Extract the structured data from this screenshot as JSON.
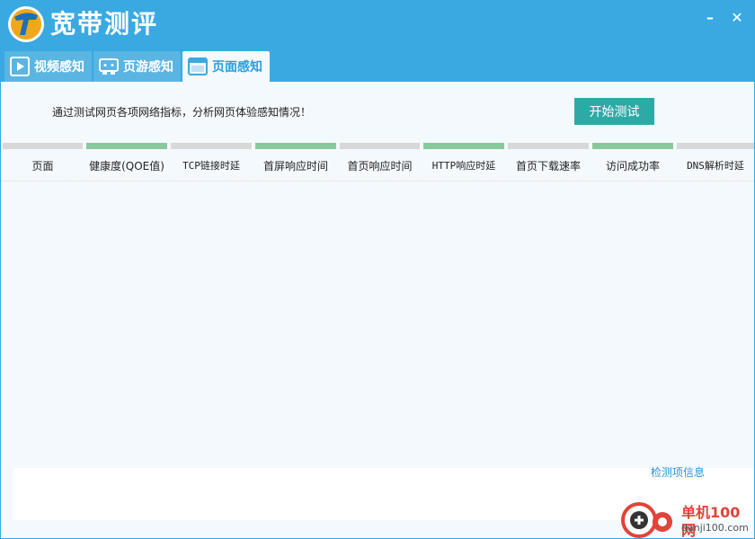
{
  "app": {
    "title": "宽带测评",
    "minimize": "–",
    "close": "✕"
  },
  "tabs": [
    {
      "label": "视频感知",
      "icon": "play-video-icon",
      "active": false
    },
    {
      "label": "页游感知",
      "icon": "gamepad-icon",
      "active": false
    },
    {
      "label": "页面感知",
      "icon": "browser-window-icon",
      "active": true
    }
  ],
  "intro_text": "通过测试网页各项网络指标，分析网页体验感知情况！",
  "start_button": "开始测试",
  "metrics": [
    {
      "label": "页面",
      "highlight": false
    },
    {
      "label": "健康度(QOE值)",
      "highlight": true
    },
    {
      "label": "TCP链接时延",
      "highlight": false
    },
    {
      "label": "首屏响应时间",
      "highlight": true
    },
    {
      "label": "首页响应时间",
      "highlight": false
    },
    {
      "label": "HTTP响应时延",
      "highlight": true
    },
    {
      "label": "首页下载速率",
      "highlight": false
    },
    {
      "label": "访问成功率",
      "highlight": true
    },
    {
      "label": "DNS解析时延",
      "highlight": false
    }
  ],
  "detail_link": "检测项信息",
  "watermark": {
    "site_name": "单机100网",
    "site_url": "danji100.com"
  },
  "colors": {
    "titlebar": "#3aa9e2",
    "tab_active_text": "#2a9ee0",
    "start_button": "#2eaaa6",
    "bar_highlight": "#88c99b",
    "bar_normal": "#d8d8d8",
    "content_bg": "#f4f9fd"
  }
}
